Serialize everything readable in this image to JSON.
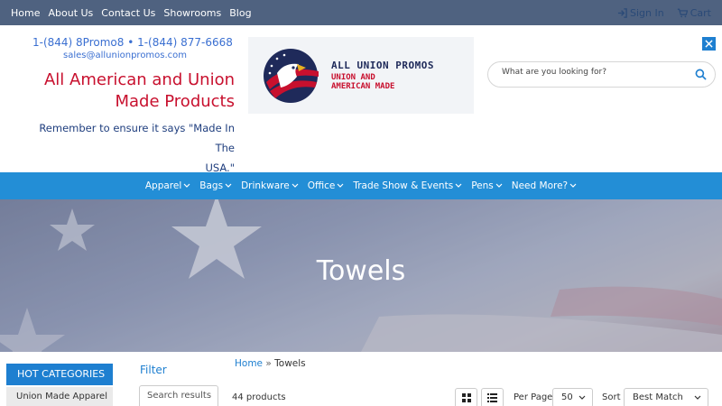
{
  "topbar": {
    "links": [
      "Home",
      "About Us",
      "Contact Us",
      "Showrooms",
      "Blog"
    ],
    "sign_in": "Sign In",
    "cart": "Cart"
  },
  "header": {
    "phones": "1-(844) 8Promo8 • 1-(844) 877-6668",
    "email": "sales@allunionpromos.com",
    "brand_line1": "All American and Union",
    "brand_line2": "Made Products",
    "tagline_line1": "Remember to ensure it says \"Made In The",
    "tagline_line2": "USA.\"",
    "logo_line1": "ALL UNION PROMOS",
    "logo_line2": "UNION AND",
    "logo_line3": "AMERICAN MADE"
  },
  "search": {
    "placeholder": "What are you looking for?"
  },
  "nav": {
    "items": [
      "Apparel",
      "Bags",
      "Drinkware",
      "Office",
      "Trade Show & Events",
      "Pens",
      "Need More?"
    ]
  },
  "hero": {
    "title": "Towels"
  },
  "sidebar": {
    "hot_categories": "HOT CATEGORIES",
    "first_category": "Union Made Apparel"
  },
  "filter": {
    "title": "Filter",
    "search_placeholder": "Search results"
  },
  "breadcrumb": {
    "home": "Home",
    "separator": "»",
    "current": "Towels"
  },
  "results": {
    "count": "44 products",
    "per_page_label": "Per Page",
    "per_page_value": "50",
    "sort_label": "Sort",
    "sort_value": "Best Match"
  },
  "colors": {
    "topbar": "#4f6280",
    "nav": "#238ed6",
    "accent_blue": "#1e7fd0",
    "brand_red": "#c8102e",
    "tagline_navy": "#1f3e7e"
  }
}
